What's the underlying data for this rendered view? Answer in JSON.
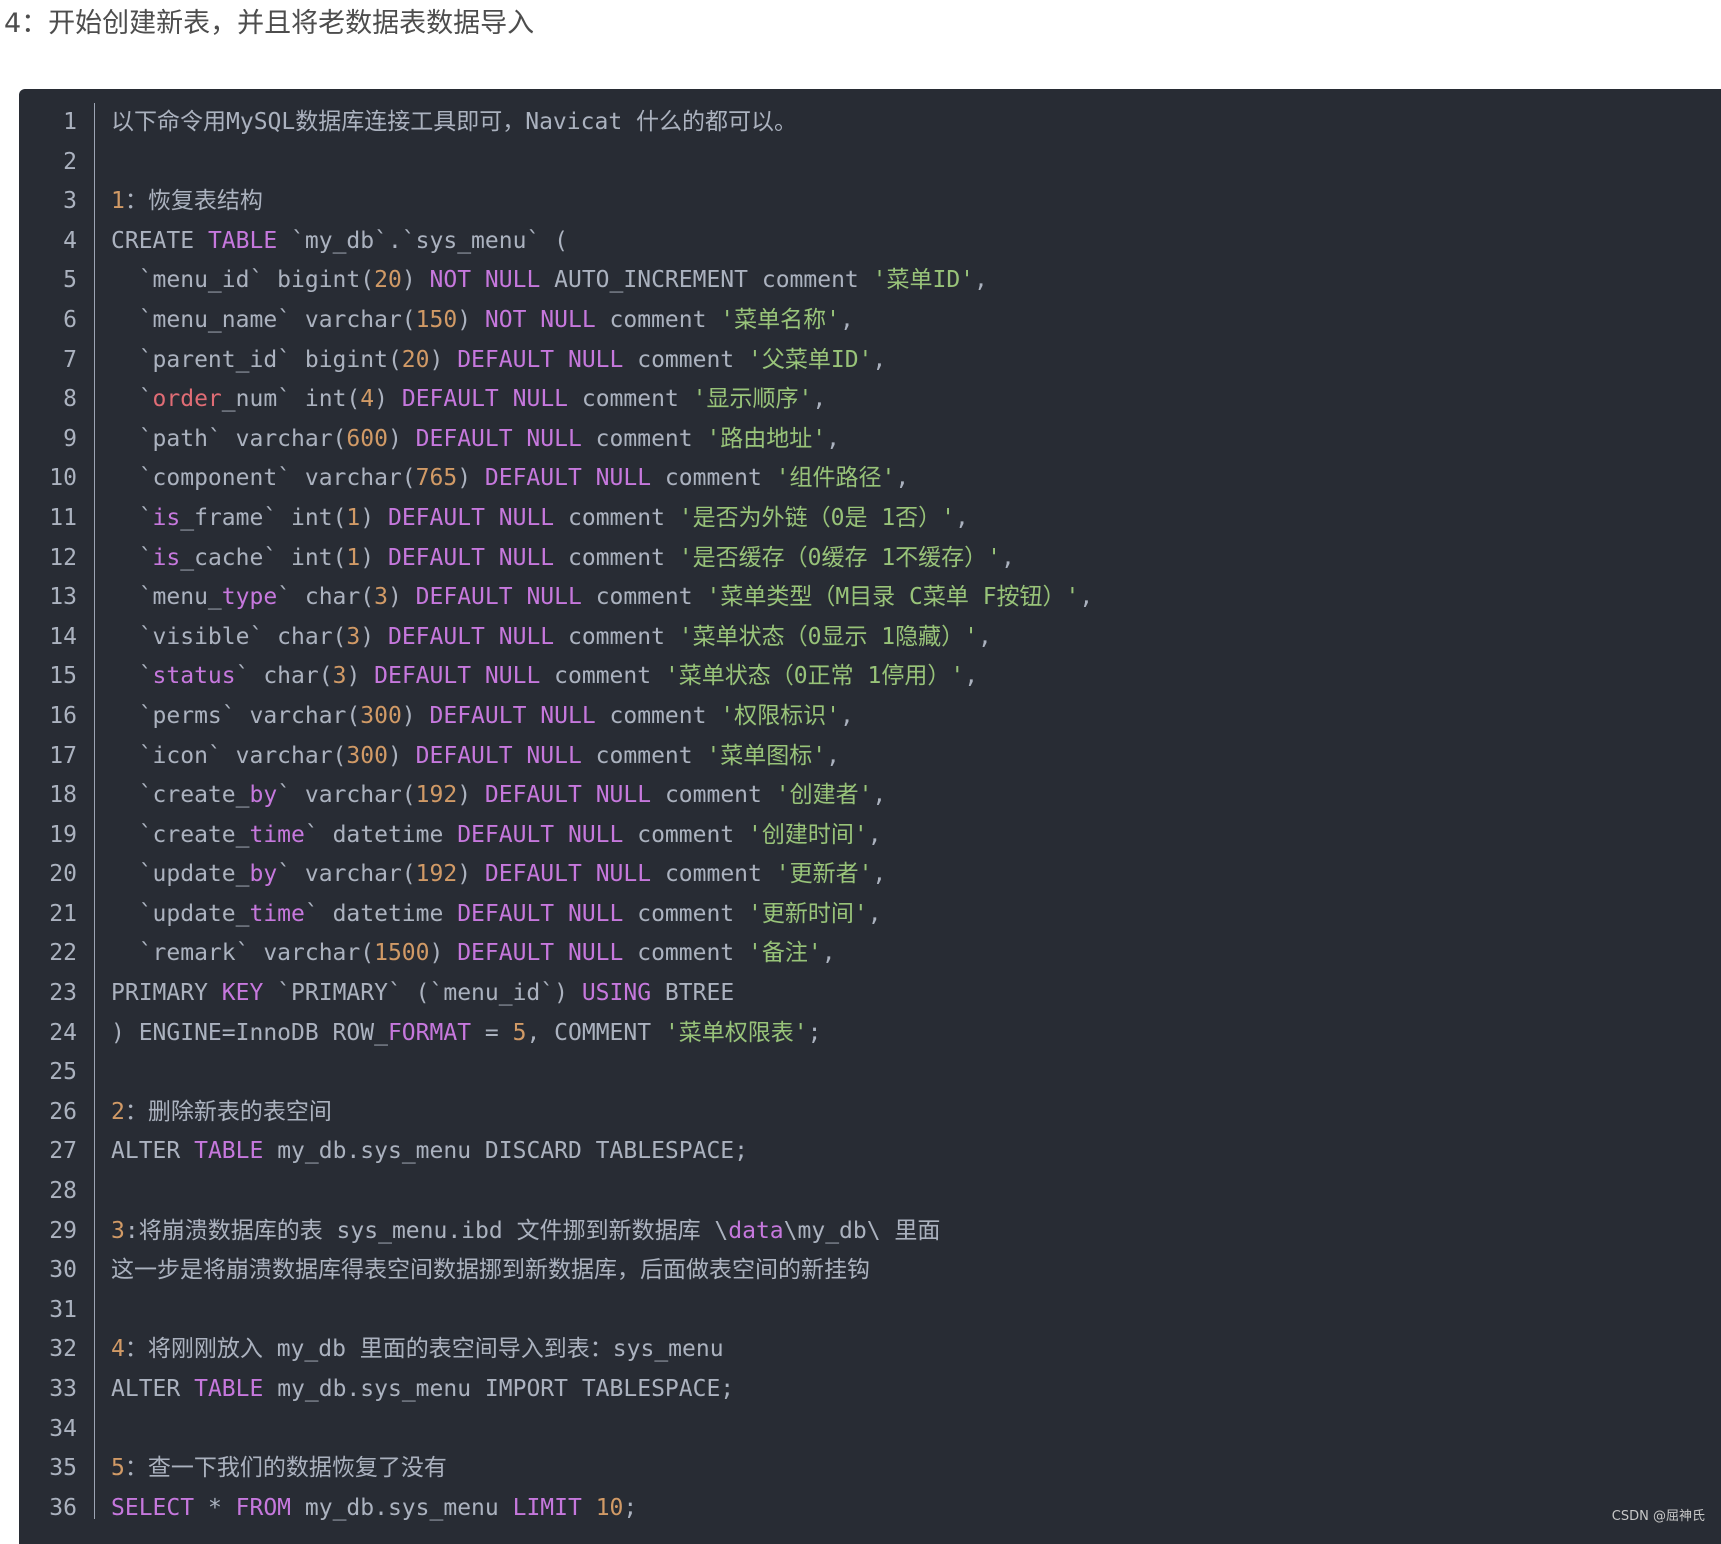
{
  "heading": "4：开始创建新表，并且将老数据表数据导入",
  "watermark": "CSDN @屈神氏",
  "colors": {
    "background": "#282c34",
    "plain": "#abb2bf",
    "keyword": "#c678dd",
    "string": "#98c379",
    "number": "#d19a66",
    "variable": "#e06c75"
  },
  "code_lines": [
    [
      [
        "plain",
        "以下命令用MySQL数据库连接工具即可，Navicat 什么的都可以。"
      ]
    ],
    [],
    [
      [
        "num",
        "1"
      ],
      [
        "plain",
        "：恢复表结构"
      ]
    ],
    [
      [
        "plain",
        "CREATE "
      ],
      [
        "kw",
        "TABLE"
      ],
      [
        "plain",
        " `my_db`.`sys_menu` ("
      ]
    ],
    [
      [
        "plain",
        "  `menu_id` bigint("
      ],
      [
        "num",
        "20"
      ],
      [
        "plain",
        ") "
      ],
      [
        "kw",
        "NOT NULL"
      ],
      [
        "plain",
        " AUTO_INCREMENT comment "
      ],
      [
        "str",
        "'菜单ID'"
      ],
      [
        "plain",
        ","
      ]
    ],
    [
      [
        "plain",
        "  `menu_name` varchar("
      ],
      [
        "num",
        "150"
      ],
      [
        "plain",
        ") "
      ],
      [
        "kw",
        "NOT NULL"
      ],
      [
        "plain",
        " comment "
      ],
      [
        "str",
        "'菜单名称'"
      ],
      [
        "plain",
        ","
      ]
    ],
    [
      [
        "plain",
        "  `parent_id` bigint("
      ],
      [
        "num",
        "20"
      ],
      [
        "plain",
        ") "
      ],
      [
        "kw",
        "DEFAULT NULL"
      ],
      [
        "plain",
        " comment "
      ],
      [
        "str",
        "'父菜单ID'"
      ],
      [
        "plain",
        ","
      ]
    ],
    [
      [
        "plain",
        "  `"
      ],
      [
        "var",
        "order"
      ],
      [
        "plain",
        "_num` int("
      ],
      [
        "num",
        "4"
      ],
      [
        "plain",
        ") "
      ],
      [
        "kw",
        "DEFAULT NULL"
      ],
      [
        "plain",
        " comment "
      ],
      [
        "str",
        "'显示顺序'"
      ],
      [
        "plain",
        ","
      ]
    ],
    [
      [
        "plain",
        "  `path` varchar("
      ],
      [
        "num",
        "600"
      ],
      [
        "plain",
        ") "
      ],
      [
        "kw",
        "DEFAULT NULL"
      ],
      [
        "plain",
        " comment "
      ],
      [
        "str",
        "'路由地址'"
      ],
      [
        "plain",
        ","
      ]
    ],
    [
      [
        "plain",
        "  `component` varchar("
      ],
      [
        "num",
        "765"
      ],
      [
        "plain",
        ") "
      ],
      [
        "kw",
        "DEFAULT NULL"
      ],
      [
        "plain",
        " comment "
      ],
      [
        "str",
        "'组件路径'"
      ],
      [
        "plain",
        ","
      ]
    ],
    [
      [
        "plain",
        "  `"
      ],
      [
        "kw",
        "is"
      ],
      [
        "plain",
        "_frame` int("
      ],
      [
        "num",
        "1"
      ],
      [
        "plain",
        ") "
      ],
      [
        "kw",
        "DEFAULT NULL"
      ],
      [
        "plain",
        " comment "
      ],
      [
        "str",
        "'是否为外链（0是 1否）'"
      ],
      [
        "plain",
        ","
      ]
    ],
    [
      [
        "plain",
        "  `"
      ],
      [
        "kw",
        "is"
      ],
      [
        "plain",
        "_cache` int("
      ],
      [
        "num",
        "1"
      ],
      [
        "plain",
        ") "
      ],
      [
        "kw",
        "DEFAULT NULL"
      ],
      [
        "plain",
        " comment "
      ],
      [
        "str",
        "'是否缓存（0缓存 1不缓存）'"
      ],
      [
        "plain",
        ","
      ]
    ],
    [
      [
        "plain",
        "  `menu_"
      ],
      [
        "kw",
        "type"
      ],
      [
        "plain",
        "` char("
      ],
      [
        "num",
        "3"
      ],
      [
        "plain",
        ") "
      ],
      [
        "kw",
        "DEFAULT NULL"
      ],
      [
        "plain",
        " comment "
      ],
      [
        "str",
        "'菜单类型（M目录 C菜单 F按钮）'"
      ],
      [
        "plain",
        ","
      ]
    ],
    [
      [
        "plain",
        "  `visible` char("
      ],
      [
        "num",
        "3"
      ],
      [
        "plain",
        ") "
      ],
      [
        "kw",
        "DEFAULT NULL"
      ],
      [
        "plain",
        " comment "
      ],
      [
        "str",
        "'菜单状态（0显示 1隐藏）'"
      ],
      [
        "plain",
        ","
      ]
    ],
    [
      [
        "plain",
        "  `"
      ],
      [
        "kw",
        "status"
      ],
      [
        "plain",
        "` char("
      ],
      [
        "num",
        "3"
      ],
      [
        "plain",
        ") "
      ],
      [
        "kw",
        "DEFAULT NULL"
      ],
      [
        "plain",
        " comment "
      ],
      [
        "str",
        "'菜单状态（0正常 1停用）'"
      ],
      [
        "plain",
        ","
      ]
    ],
    [
      [
        "plain",
        "  `perms` varchar("
      ],
      [
        "num",
        "300"
      ],
      [
        "plain",
        ") "
      ],
      [
        "kw",
        "DEFAULT NULL"
      ],
      [
        "plain",
        " comment "
      ],
      [
        "str",
        "'权限标识'"
      ],
      [
        "plain",
        ","
      ]
    ],
    [
      [
        "plain",
        "  `icon` varchar("
      ],
      [
        "num",
        "300"
      ],
      [
        "plain",
        ") "
      ],
      [
        "kw",
        "DEFAULT NULL"
      ],
      [
        "plain",
        " comment "
      ],
      [
        "str",
        "'菜单图标'"
      ],
      [
        "plain",
        ","
      ]
    ],
    [
      [
        "plain",
        "  `create_"
      ],
      [
        "kw",
        "by"
      ],
      [
        "plain",
        "` varchar("
      ],
      [
        "num",
        "192"
      ],
      [
        "plain",
        ") "
      ],
      [
        "kw",
        "DEFAULT NULL"
      ],
      [
        "plain",
        " comment "
      ],
      [
        "str",
        "'创建者'"
      ],
      [
        "plain",
        ","
      ]
    ],
    [
      [
        "plain",
        "  `create_"
      ],
      [
        "kw",
        "time"
      ],
      [
        "plain",
        "` datetime "
      ],
      [
        "kw",
        "DEFAULT NULL"
      ],
      [
        "plain",
        " comment "
      ],
      [
        "str",
        "'创建时间'"
      ],
      [
        "plain",
        ","
      ]
    ],
    [
      [
        "plain",
        "  `update_"
      ],
      [
        "kw",
        "by"
      ],
      [
        "plain",
        "` varchar("
      ],
      [
        "num",
        "192"
      ],
      [
        "plain",
        ") "
      ],
      [
        "kw",
        "DEFAULT NULL"
      ],
      [
        "plain",
        " comment "
      ],
      [
        "str",
        "'更新者'"
      ],
      [
        "plain",
        ","
      ]
    ],
    [
      [
        "plain",
        "  `update_"
      ],
      [
        "kw",
        "time"
      ],
      [
        "plain",
        "` datetime "
      ],
      [
        "kw",
        "DEFAULT NULL"
      ],
      [
        "plain",
        " comment "
      ],
      [
        "str",
        "'更新时间'"
      ],
      [
        "plain",
        ","
      ]
    ],
    [
      [
        "plain",
        "  `remark` varchar("
      ],
      [
        "num",
        "1500"
      ],
      [
        "plain",
        ") "
      ],
      [
        "kw",
        "DEFAULT NULL"
      ],
      [
        "plain",
        " comment "
      ],
      [
        "str",
        "'备注'"
      ],
      [
        "plain",
        ","
      ]
    ],
    [
      [
        "plain",
        "PRIMARY "
      ],
      [
        "kw",
        "KEY"
      ],
      [
        "plain",
        " `PRIMARY` (`menu_id`) "
      ],
      [
        "kw",
        "USING"
      ],
      [
        "plain",
        " BTREE"
      ]
    ],
    [
      [
        "plain",
        ") ENGINE=InnoDB ROW_"
      ],
      [
        "kw",
        "FORMAT"
      ],
      [
        "plain",
        " = "
      ],
      [
        "num",
        "5"
      ],
      [
        "plain",
        ", COMMENT "
      ],
      [
        "str",
        "'菜单权限表'"
      ],
      [
        "plain",
        ";"
      ]
    ],
    [],
    [
      [
        "num",
        "2"
      ],
      [
        "plain",
        "：删除新表的表空间"
      ]
    ],
    [
      [
        "plain",
        "ALTER "
      ],
      [
        "kw",
        "TABLE"
      ],
      [
        "plain",
        " my_db.sys_menu DISCARD TABLESPACE;"
      ]
    ],
    [],
    [
      [
        "num",
        "3"
      ],
      [
        "plain",
        ":将崩溃数据库的表 sys_menu.ibd 文件挪到新数据库 \\"
      ],
      [
        "kw",
        "data"
      ],
      [
        "plain",
        "\\my_db\\ 里面"
      ]
    ],
    [
      [
        "plain",
        "这一步是将崩溃数据库得表空间数据挪到新数据库，后面做表空间的新挂钩"
      ]
    ],
    [],
    [
      [
        "num",
        "4"
      ],
      [
        "plain",
        "：将刚刚放入 my_db 里面的表空间导入到表：sys_menu"
      ]
    ],
    [
      [
        "plain",
        "ALTER "
      ],
      [
        "kw",
        "TABLE"
      ],
      [
        "plain",
        " my_db.sys_menu IMPORT TABLESPACE;"
      ]
    ],
    [],
    [
      [
        "num",
        "5"
      ],
      [
        "plain",
        "：查一下我们的数据恢复了没有"
      ]
    ],
    [
      [
        "kw",
        "SELECT"
      ],
      [
        "plain",
        " * "
      ],
      [
        "kw",
        "FROM"
      ],
      [
        "plain",
        " my_db.sys_menu "
      ],
      [
        "kw",
        "LIMIT"
      ],
      [
        "plain",
        " "
      ],
      [
        "num",
        "10"
      ],
      [
        "plain",
        ";"
      ]
    ]
  ]
}
